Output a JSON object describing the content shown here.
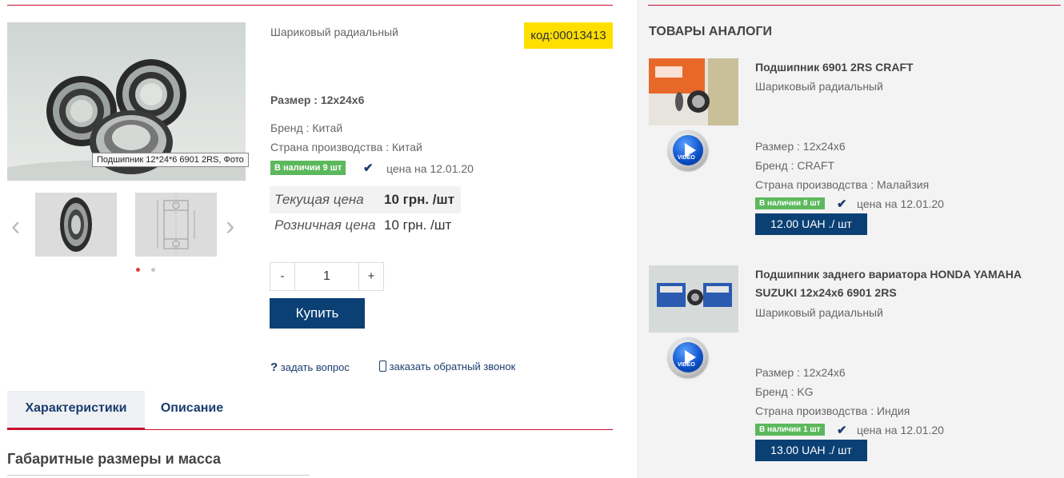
{
  "product": {
    "subtitle": "Шариковый радиальный",
    "code": "код:00013413",
    "size": "Размер : 12x24x6",
    "brand": "Бренд : Китай",
    "country": "Страна производства : Китай",
    "stock_badge": "В наличии 9 шт",
    "price_date": "цена на  12.01.20",
    "current_price_label": "Текущая цена",
    "current_price": "10 грн. /шт",
    "retail_price_label": "Розничная цена",
    "retail_price": "10 грн. /шт",
    "image_tooltip": "Подшипник  12*24*6 6901 2RS, Фото",
    "quantity": "1",
    "qty_minus": "-",
    "qty_plus": "+",
    "buy_label": "Купить",
    "ask_question": "задать вопрос",
    "callback": "заказать обратный звонок"
  },
  "gallery": {
    "arrow_left": "‹",
    "arrow_right": "›",
    "active_dot_color": "#e23b3b",
    "dot_color": "#c7c7c7"
  },
  "tabs": [
    {
      "label": "Характеристики",
      "active": true
    },
    {
      "label": "Описание",
      "active": false
    }
  ],
  "section_title": "Габаритные размеры и масса",
  "analogs": {
    "title": "ТОВАРЫ АНАЛОГИ",
    "video_label": "VIDEO",
    "items": [
      {
        "name": "Подшипник 6901 2RS CRAFT",
        "subtitle": "Шариковый радиальный",
        "size": "Размер : 12x24x6",
        "brand": "Бренд : CRAFT",
        "country": "Страна производства : Малайзия",
        "stock": "В наличии 8 шт",
        "price_date": "цена на  12.01.20",
        "price": "12.00 UAH ./ шт"
      },
      {
        "name_line1": "Подшипник заднего вариатора HONDA YAMAHA",
        "name_line2": "SUZUKI 12x24x6 6901 2RS",
        "subtitle": "Шариковый радиальный",
        "size": "Размер : 12x24x6",
        "brand": "Бренд : KG",
        "country": "Страна производства : Индия",
        "stock": "В наличии 1 шт",
        "price_date": "цена на  12.01.20",
        "price": "13.00 UAH ./ шт"
      }
    ]
  },
  "colors": {
    "accent_red": "#c8102e",
    "navy": "#0b4074",
    "code_yellow": "#ffdf00",
    "stock_green": "#5cb85c"
  }
}
